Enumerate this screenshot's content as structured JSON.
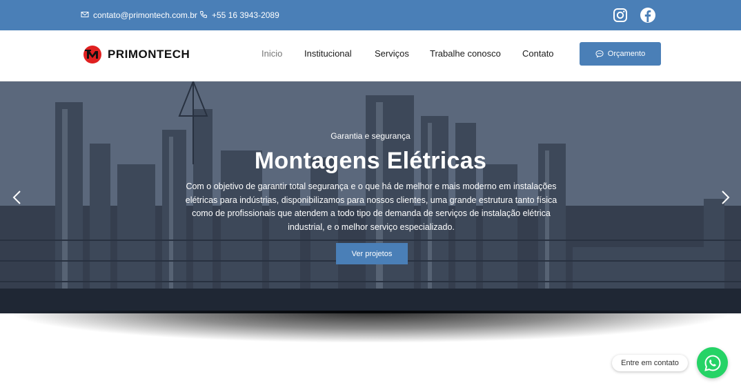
{
  "topbar": {
    "email": "contato@primontech.com.br",
    "phone": "+55 16 3943-2089",
    "icons": [
      "email-icon",
      "phone-icon",
      "instagram-icon",
      "facebook-icon"
    ]
  },
  "header": {
    "logo_text": "PRIMONTECH",
    "nav": [
      {
        "label": "Inicio",
        "active": true
      },
      {
        "label": "Institucional",
        "active": false
      },
      {
        "label": "Serviços",
        "active": false
      },
      {
        "label": "Trabalhe conosco",
        "active": false
      },
      {
        "label": "Contato",
        "active": false
      }
    ],
    "cta_label": "Orçamento"
  },
  "hero": {
    "subtitle": "Garantia e segurança",
    "title": "Montagens Elétricas",
    "text": "Com o objetivo de garantir total segurança e o que há de melhor e mais moderno em instalações elétricas para indústrias, disponibilizamos para nossos clientes, uma grande estrutura tanto física como de profissionais que atendem a todo tipo de demanda de serviços de instalação elétrica industrial, e o melhor serviço especializado.",
    "button_label": "Ver projetos"
  },
  "chat": {
    "bubble_label": "Entre em contato"
  },
  "colors": {
    "brand_blue": "#4a7fb7",
    "whatsapp_green": "#25d366",
    "logo_red": "#e02020"
  }
}
